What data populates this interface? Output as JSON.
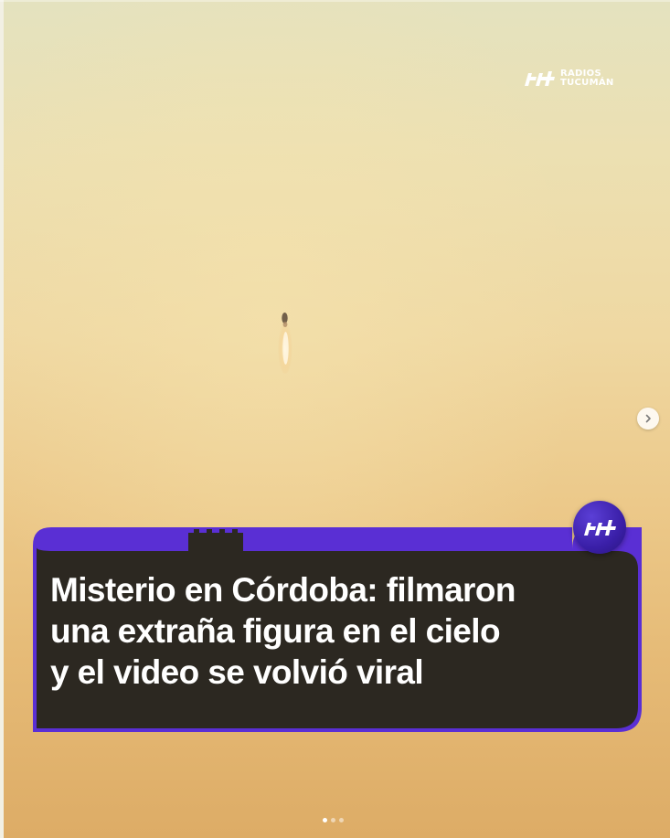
{
  "watermark": {
    "line1": "RADIOS",
    "line2": "TUCUMÁN"
  },
  "headline": {
    "lines": [
      "Misterio en Córdoba: filmaron",
      "una extraña figura en el cielo",
      "y el video se volvió viral"
    ]
  },
  "carousel": {
    "total_slides": 3,
    "active_slide": 1
  },
  "colors": {
    "card_fill": "#2c2821",
    "card_border": "#5a2fd4",
    "brand_purple": "#4a27c4",
    "sky_top": "#e4e2bf",
    "sky_bottom": "#ddac66"
  },
  "icons": {
    "watermark_logo": "radios-tucuman-logo",
    "card_logo": "rt-logo-badge",
    "next": "chevron-right-icon"
  }
}
